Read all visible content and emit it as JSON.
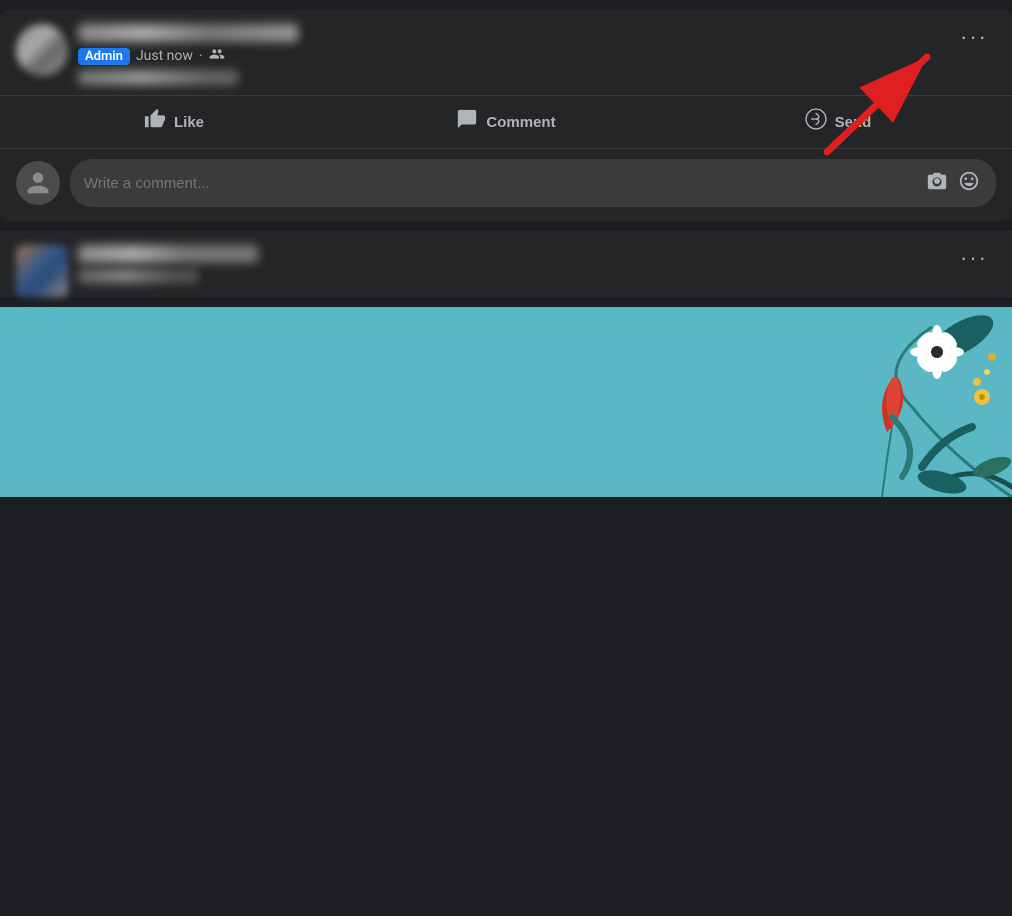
{
  "post": {
    "admin_badge": "Admin",
    "time": "Just now",
    "privacy_icon": "🌐",
    "more_button_label": "···",
    "actions": [
      {
        "id": "like",
        "label": "Like",
        "icon": "👍"
      },
      {
        "id": "comment",
        "label": "Comment",
        "icon": "💬"
      },
      {
        "id": "send",
        "label": "Send",
        "icon": "✉"
      }
    ],
    "comment_placeholder": "Write a comment..."
  },
  "post2": {
    "more_button_label": "···"
  },
  "icons": {
    "camera": "📷",
    "emoji": "🙂"
  }
}
